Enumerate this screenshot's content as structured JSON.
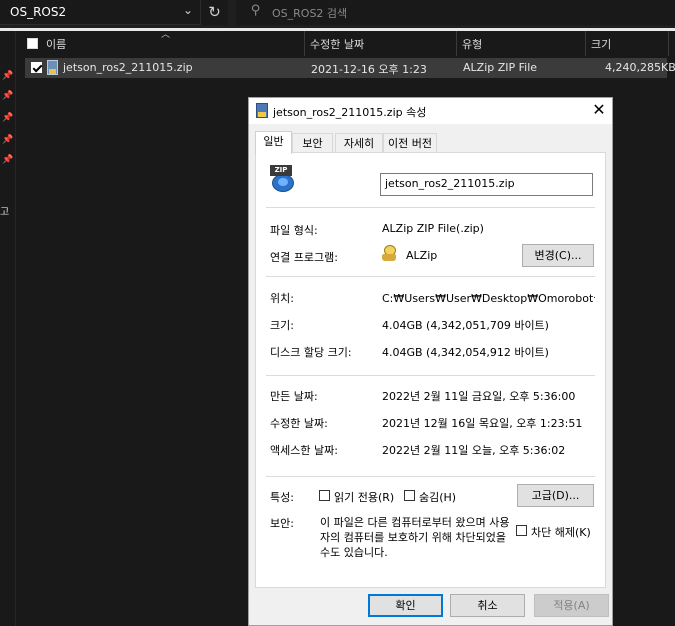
{
  "explorer": {
    "path": "OS_ROS2",
    "search_placeholder": "OS_ROS2 검색",
    "nav_glyph": "고",
    "columns": [
      "이름",
      "수정한 날짜",
      "유형",
      "크기"
    ],
    "file": {
      "name": "jetson_ros2_211015.zip",
      "modified": "2021-12-16 오후 1:23",
      "type": "ALZip ZIP File",
      "size": "4,240,285KB"
    }
  },
  "dialog": {
    "title": "jetson_ros2_211015.zip 속성",
    "tabs": [
      "일반",
      "보안",
      "자세히",
      "이전 버전"
    ],
    "filename_value": "jetson_ros2_211015.zip",
    "labels": {
      "file_type": "파일 형식:",
      "open_with": "연결 프로그램:",
      "location": "위치:",
      "size": "크기:",
      "size_on_disk": "디스크 할당 크기:",
      "created": "만든 날짜:",
      "modified": "수정한 날짜:",
      "accessed": "액세스한 날짜:",
      "attributes": "특성:",
      "security": "보안:"
    },
    "values": {
      "file_type": "ALZip ZIP File(.zip)",
      "open_with": "ALZip",
      "location": "C:₩Users₩User₩Desktop₩Omorobot실습₩설치",
      "size": "4.04GB (4,342,051,709 바이트)",
      "size_on_disk": "4.04GB (4,342,054,912 바이트)",
      "created": "2022년 2월 11일 금요일, 오후 5:36:00",
      "modified": "2021년 12월 16일 목요일, 오후 1:23:51",
      "accessed": "2022년 2월 11일 오늘, 오후 5:36:02"
    },
    "attributes": {
      "readonly": "읽기 전용(R)",
      "hidden": "숨김(H)",
      "advanced_button": "고급(D)..."
    },
    "change_button": "변경(C)...",
    "security_text": "이 파일은 다른 컴퓨터로부터 왔으며 사용자의 컴퓨터를 보호하기 위해 차단되었을 수도 있습니다.",
    "unblock_label": "차단 해제(K)",
    "buttons": {
      "ok": "확인",
      "cancel": "취소",
      "apply": "적용(A)"
    }
  }
}
